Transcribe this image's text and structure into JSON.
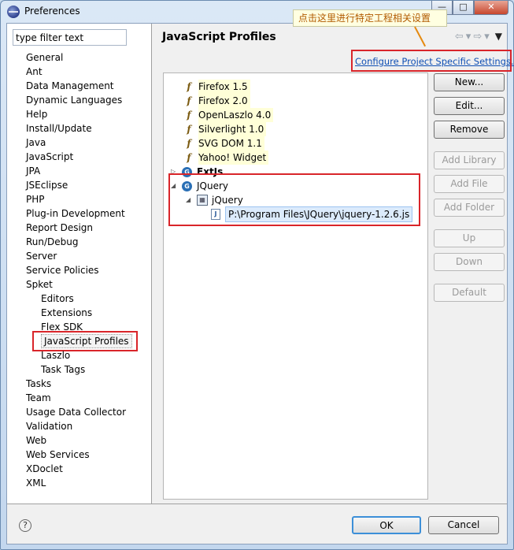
{
  "window": {
    "title": "Preferences"
  },
  "filter": {
    "value": "type filter text"
  },
  "nav_tree": [
    {
      "label": "General",
      "level": 0
    },
    {
      "label": "Ant",
      "level": 0
    },
    {
      "label": "Data Management",
      "level": 0
    },
    {
      "label": "Dynamic Languages",
      "level": 0
    },
    {
      "label": "Help",
      "level": 0
    },
    {
      "label": "Install/Update",
      "level": 0
    },
    {
      "label": "Java",
      "level": 0
    },
    {
      "label": "JavaScript",
      "level": 0
    },
    {
      "label": "JPA",
      "level": 0
    },
    {
      "label": "JSEclipse",
      "level": 0
    },
    {
      "label": "PHP",
      "level": 0
    },
    {
      "label": "Plug-in Development",
      "level": 0
    },
    {
      "label": "Report Design",
      "level": 0
    },
    {
      "label": "Run/Debug",
      "level": 0
    },
    {
      "label": "Server",
      "level": 0
    },
    {
      "label": "Service Policies",
      "level": 0
    },
    {
      "label": "Spket",
      "level": 0
    },
    {
      "label": "Editors",
      "level": 1
    },
    {
      "label": "Extensions",
      "level": 1
    },
    {
      "label": "Flex SDK",
      "level": 1
    },
    {
      "label": "JavaScript Profiles",
      "level": 1,
      "selected": true
    },
    {
      "label": "Laszlo",
      "level": 1
    },
    {
      "label": "Task Tags",
      "level": 1
    },
    {
      "label": "Tasks",
      "level": 0
    },
    {
      "label": "Team",
      "level": 0
    },
    {
      "label": "Usage Data Collector",
      "level": 0
    },
    {
      "label": "Validation",
      "level": 0
    },
    {
      "label": "Web",
      "level": 0
    },
    {
      "label": "Web Services",
      "level": 0
    },
    {
      "label": "XDoclet",
      "level": 0
    },
    {
      "label": "XML",
      "level": 0
    }
  ],
  "page": {
    "title": "JavaScript Profiles",
    "configure_link": "Configure Project Specific Settings...",
    "callout": "点击这里进行特定工程相关设置"
  },
  "profiles": [
    {
      "label": "Firefox 1.5",
      "icon": "function-icon"
    },
    {
      "label": "Firefox 2.0",
      "icon": "function-icon"
    },
    {
      "label": "OpenLaszlo 4.0",
      "icon": "function-icon"
    },
    {
      "label": "Silverlight 1.0",
      "icon": "function-icon"
    },
    {
      "label": "SVG DOM 1.1",
      "icon": "function-icon"
    },
    {
      "label": "Yahoo! Widget",
      "icon": "function-icon"
    }
  ],
  "profile_groups": {
    "extjs": {
      "label": "ExtJs"
    },
    "jquery": {
      "label": "JQuery"
    },
    "jquery_lib": {
      "label": "jQuery"
    },
    "jquery_file": {
      "label": "P:\\Program Files\\JQuery\\jquery-1.2.6.js"
    }
  },
  "buttons": {
    "new": "New...",
    "edit": "Edit...",
    "remove": "Remove",
    "add_library": "Add Library",
    "add_file": "Add File",
    "add_folder": "Add Folder",
    "up": "Up",
    "down": "Down",
    "default": "Default",
    "ok": "OK",
    "cancel": "Cancel"
  },
  "colors": {
    "link": "#0f4fb4",
    "annotation_box": "#d9252a",
    "callout_text": "#b25a00"
  }
}
